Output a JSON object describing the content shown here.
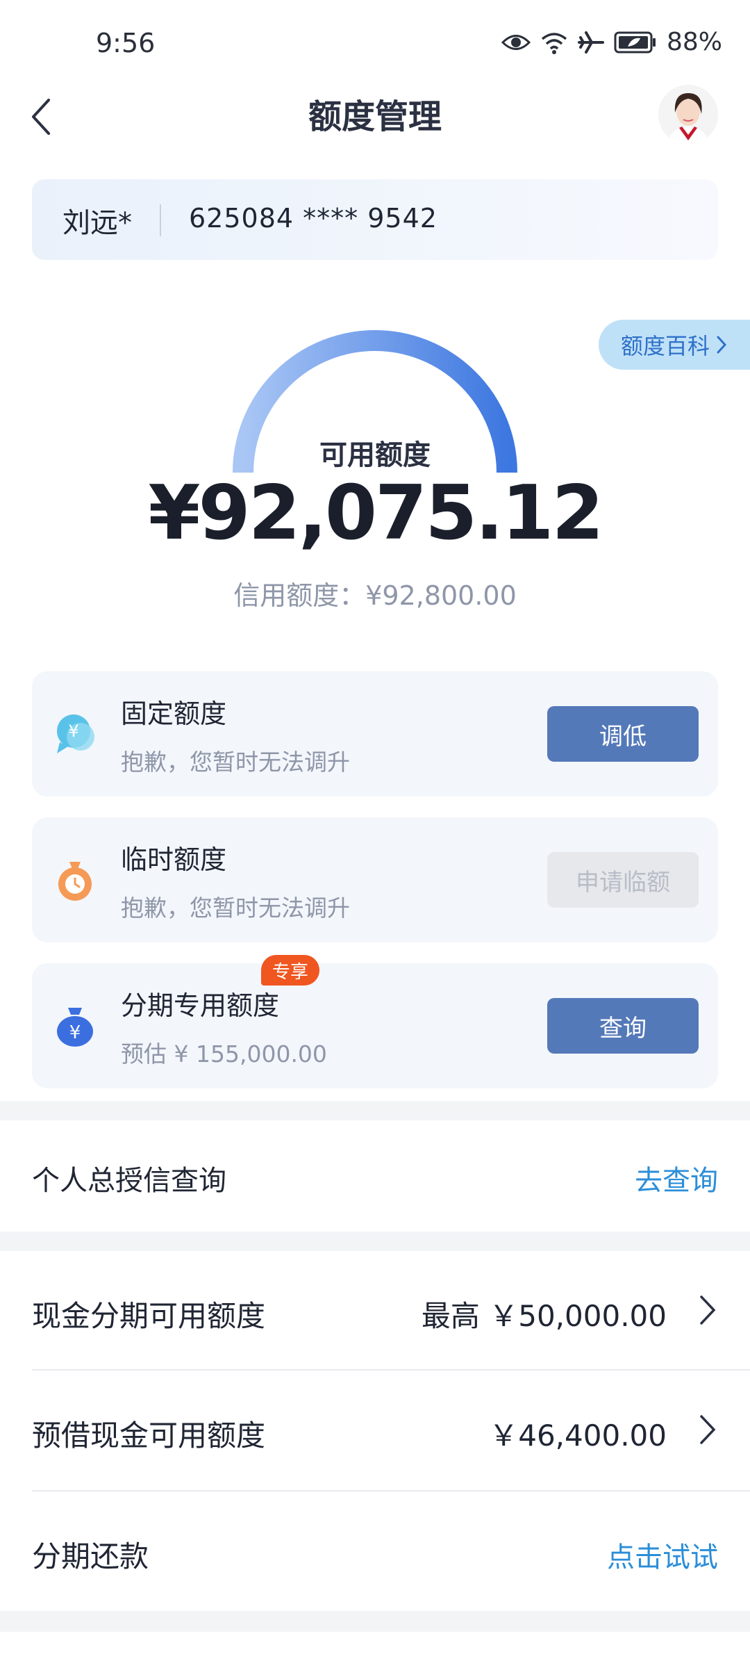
{
  "status": {
    "time": "9:56",
    "battery": "88%"
  },
  "header": {
    "title": "额度管理"
  },
  "account": {
    "name": "刘远*",
    "card_number": "625084 **** 9542"
  },
  "wiki_link": "额度百科",
  "summary": {
    "available_label": "可用额度",
    "available_amount": "¥92,075.12",
    "credit_line": "信用额度：¥92,800.00"
  },
  "cards": [
    {
      "name": "固定额度",
      "sub": "抱歉，您暂时无法调升",
      "button": "调低",
      "icon": "yen-chat-icon"
    },
    {
      "name": "临时额度",
      "sub": "抱歉，您暂时无法调升",
      "button": "申请临额",
      "icon": "money-bag-clock-icon"
    },
    {
      "name": "分期专用额度",
      "sub": "预估 ¥ 155,000.00",
      "button": "查询",
      "tag": "专享",
      "icon": "yen-bag-icon"
    }
  ],
  "credit_query": {
    "label": "个人总授信查询",
    "link": "去查询"
  },
  "list": [
    {
      "label": "现金分期可用额度",
      "value": "最高 ￥50,000.00"
    },
    {
      "label": "预借现金可用额度",
      "value": "￥46,400.00"
    }
  ],
  "installment": {
    "label": "分期还款",
    "link": "点击试试"
  },
  "colors": {
    "primary_button": "#5479b9",
    "link": "#2b8ed9",
    "tag": "#f0561f",
    "gauge_start": "#a9c6f5",
    "gauge_end": "#3d77e0"
  }
}
